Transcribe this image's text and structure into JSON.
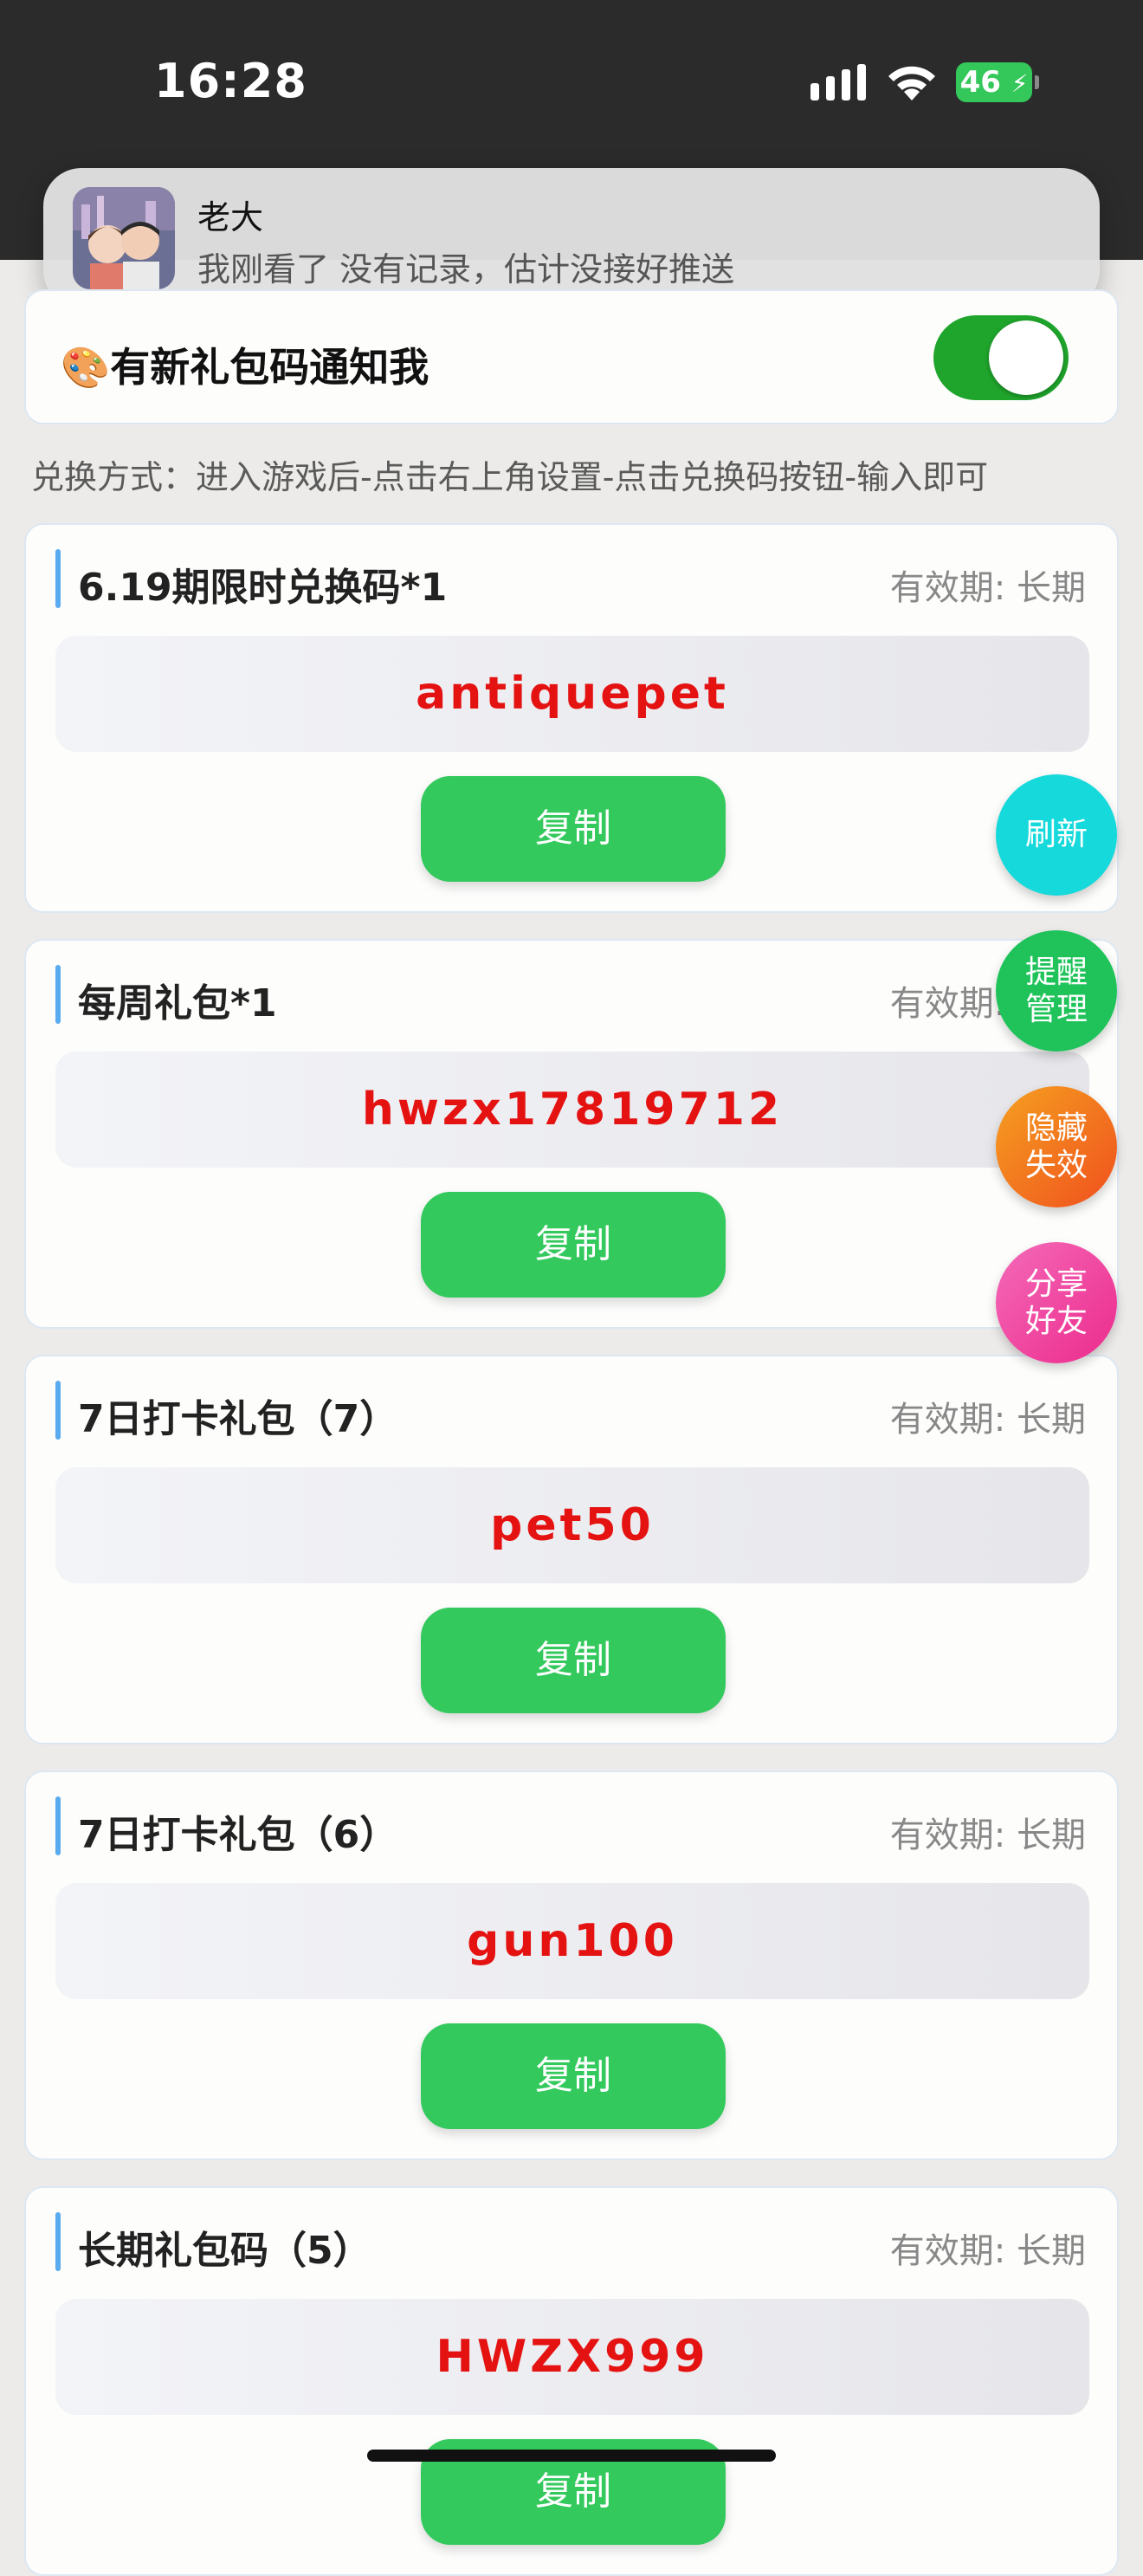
{
  "status": {
    "time": "16:28",
    "battery": "46"
  },
  "notification": {
    "sender": "老大",
    "message": "我刚看了  没有记录，估计没接好推送"
  },
  "notify_toggle": {
    "label": "🎨有新礼包码通知我",
    "on": true
  },
  "instructions": "兑换方式：进入游戏后-点击右上角设置-点击兑换码按钮-输入即可",
  "cards": [
    {
      "title": "6.19期限时兑换码*1",
      "validity": "有效期: 长期",
      "code": "antiquepet",
      "copy_label": "复制"
    },
    {
      "title": "每周礼包*1",
      "validity": "有效期: 长期",
      "code": "hwzx17819712",
      "copy_label": "复制"
    },
    {
      "title": "7日打卡礼包（7）",
      "validity": "有效期: 长期",
      "code": "pet50",
      "copy_label": "复制"
    },
    {
      "title": "7日打卡礼包（6）",
      "validity": "有效期: 长期",
      "code": "gun100",
      "copy_label": "复制"
    },
    {
      "title": "长期礼包码（5）",
      "validity": "有效期: 长期",
      "code": "HWZX999",
      "copy_label": "复制"
    }
  ],
  "fabs": {
    "refresh": "刷新",
    "reminder": "提醒管理",
    "hide_expired": "隐藏失效",
    "share": "分享好友"
  },
  "colors": {
    "accent_green": "#34c95d",
    "code_red": "#e51212",
    "toggle_green": "#1fa52c"
  }
}
